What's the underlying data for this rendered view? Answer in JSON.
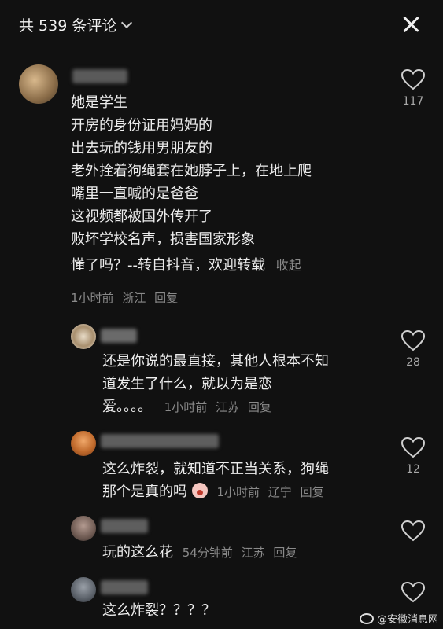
{
  "header": {
    "title": "共 539 条评论",
    "close_icon": "close-icon"
  },
  "comments": [
    {
      "lines": [
        "她是学生",
        "开房的身份证用妈妈的",
        "出去玩的钱用男朋友的",
        "老外拴着狗绳套在她脖子上，在地上爬",
        "嘴里一直喊的是爸爸",
        "这视频都被国外传开了",
        "败坏学校名声，损害国家形象",
        "懂了吗？--转自抖音，欢迎转载"
      ],
      "collapse_label": "收起",
      "time": "1小时前",
      "location": "浙江",
      "reply_label": "回复",
      "likes": "117"
    },
    {
      "lines": [
        "还是你说的最直接，其他人根本不知",
        "道发生了什么，就以为是恋",
        "爱。。。。"
      ],
      "time": "1小时前",
      "location": "江苏",
      "reply_label": "回复",
      "likes": "28"
    },
    {
      "lines": [
        "这么炸裂，就知道不正当关系，狗绳",
        "那个是真的吗"
      ],
      "time": "1小时前",
      "location": "辽宁",
      "reply_label": "回复",
      "likes": "12"
    },
    {
      "lines": [
        "玩的这么花"
      ],
      "time": "54分钟前",
      "location": "江苏",
      "reply_label": "回复",
      "likes": ""
    },
    {
      "lines": [
        "这么炸裂？？？？"
      ],
      "likes": ""
    }
  ],
  "watermark": {
    "text": "@安徽消息网",
    "icon": "weibo-icon"
  },
  "colors": {
    "background": "#111111",
    "text": "#ededed",
    "meta": "#8a8a8a"
  }
}
